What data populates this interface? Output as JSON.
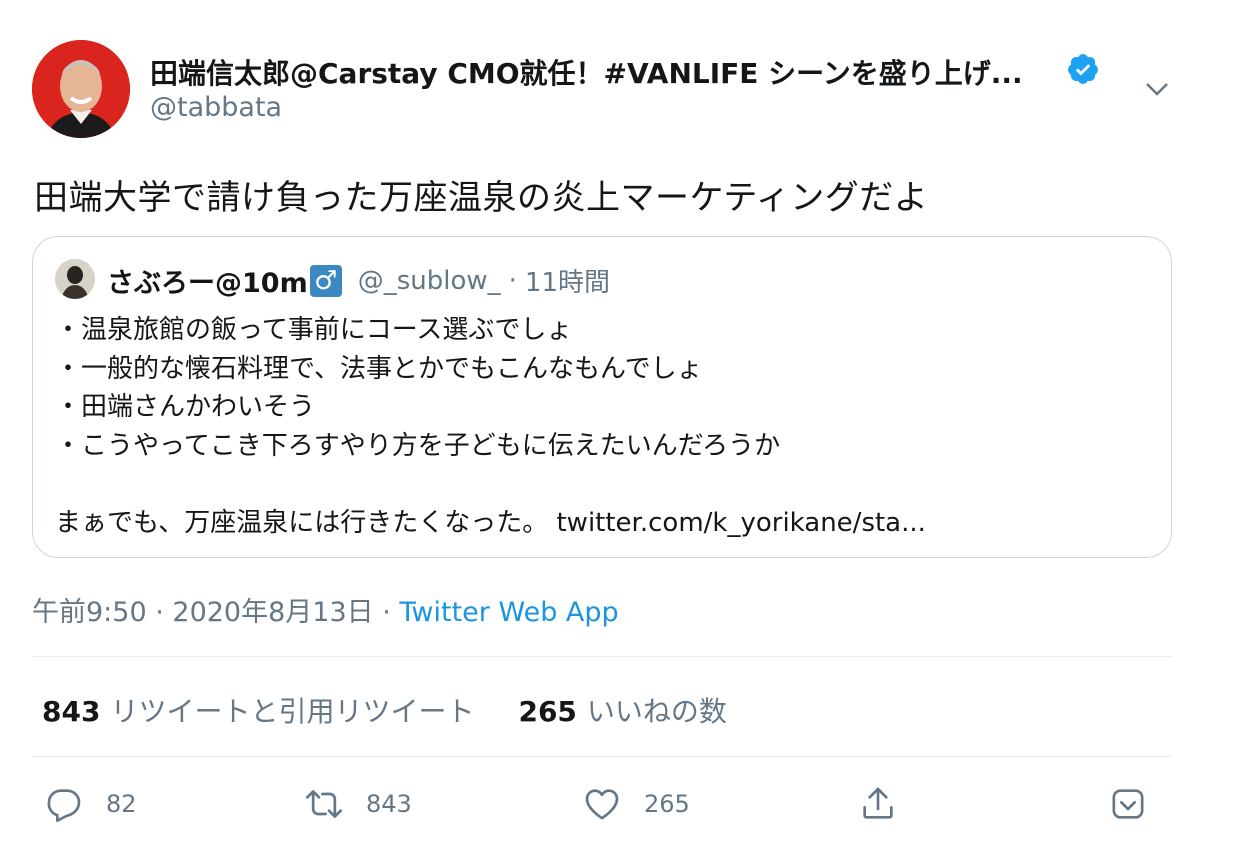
{
  "author": {
    "name": "田端信太郎@Carstay CMO就任！#VANLIFE シーンを盛り上げ...",
    "handle": "@tabbata"
  },
  "tweet": {
    "text": "田端大学で請け負った万座温泉の炎上マーケティングだよ"
  },
  "quoted": {
    "name": "さぶろー@10m",
    "emoji_symbol": "♂",
    "handle": "@_sublow_",
    "separator": "·",
    "time": "11時間",
    "lines": [
      "・温泉旅館の飯って事前にコース選ぶでしょ",
      "・一般的な懐石料理で、法事とかでもこんなもんでしょ",
      "・田端さんかわいそう",
      "・こうやってこき下ろすやり方を子どもに伝えたいんだろうか",
      "",
      "まぁでも、万座温泉には行きたくなった。 twitter.com/k_yorikane/sta..."
    ]
  },
  "meta": {
    "time": "午前9:50",
    "sep1": " · ",
    "date": "2020年8月13日",
    "sep2": " · ",
    "source": "Twitter Web App"
  },
  "stats": {
    "retweets_count": "843",
    "retweets_label": "リツイートと引用リツイート",
    "likes_count": "265",
    "likes_label": "いいねの数"
  },
  "actions": {
    "reply_count": "82",
    "retweet_count": "843",
    "like_count": "265"
  },
  "icons": {
    "verified": "verified-badge-icon",
    "caret": "chevron-down-icon",
    "reply": "reply-icon",
    "retweet": "retweet-icon",
    "like": "heart-icon",
    "share": "share-icon",
    "bookmark": "bookmark-icon"
  },
  "colors": {
    "verified": "#1da1f2",
    "link": "#1b95e0",
    "secondary_text": "#657786",
    "avatar_bg": "#d9251d"
  }
}
